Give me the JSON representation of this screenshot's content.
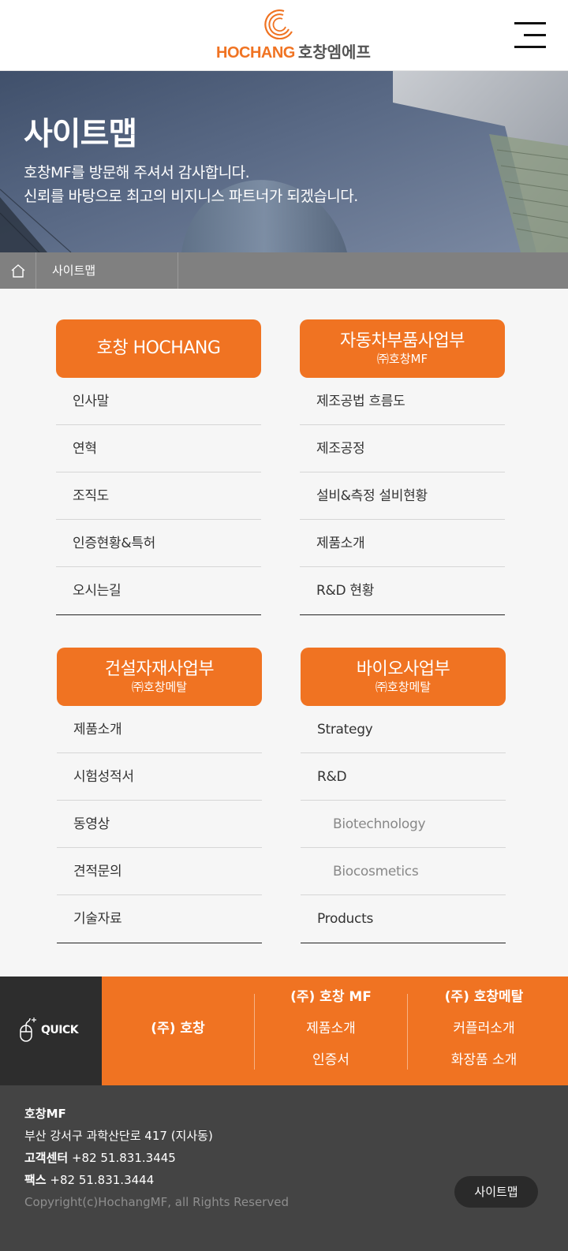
{
  "header": {
    "logo_en": "HOCHANG",
    "logo_ko": "호창엠에프",
    "menu_icon": "hamburger-menu-icon"
  },
  "hero": {
    "title": "사이트맵",
    "desc_line1": "호창MF를 방문해 주셔서 감사합니다.",
    "desc_line2": "신뢰를 바탕으로 최고의 비지니스 파트너가 되겠습니다."
  },
  "breadcrumb": {
    "home_icon": "home-icon",
    "current": "사이트맵"
  },
  "groups": [
    {
      "title": "호창 HOCHANG",
      "subtitle": "",
      "items": [
        "인사말",
        "연혁",
        "조직도",
        "인증현황&특허",
        "오시는길"
      ]
    },
    {
      "title": "자동차부품사업부",
      "subtitle": "㈜호창MF",
      "items": [
        "제조공법 흐름도",
        "제조공정",
        "설비&측정 설비현황",
        "제품소개",
        "R&D 현황"
      ]
    },
    {
      "title": "건설자재사업부",
      "subtitle": "㈜호창메탈",
      "items": [
        "제품소개",
        "시험성적서",
        "동영상",
        "견적문의",
        "기술자료"
      ]
    },
    {
      "title": "바이오사업부",
      "subtitle": "㈜호창메탈",
      "items": [
        "Strategy",
        "R&D",
        "Biotechnology",
        "Biocosmetics",
        "Products"
      ]
    }
  ],
  "quick": {
    "label": "QUICK",
    "icon": "mouse-click-icon",
    "col1": {
      "title": "(주) 호창"
    },
    "col2": {
      "title": "(주) 호창 MF",
      "links": [
        "제품소개",
        "인증서"
      ]
    },
    "col3": {
      "title": "(주) 호창메탈",
      "links": [
        "커플러소개",
        "화장품 소개"
      ]
    }
  },
  "footer": {
    "company": "호창MF",
    "address": "부산 강서구 과학산단로 417 (지사동)",
    "cs_label": "고객센터",
    "cs_phone": "+82 51.831.3445",
    "fax_label": "팩스",
    "fax_phone": "+82 51.831.3444",
    "copyright": "Copyright(c)HochangMF, all Rights Reserved",
    "sitemap_button": "사이트맵"
  },
  "colors": {
    "accent": "#f07322",
    "dark": "#2d2d2d",
    "footer": "#444444",
    "breadcrumb": "#808080"
  }
}
